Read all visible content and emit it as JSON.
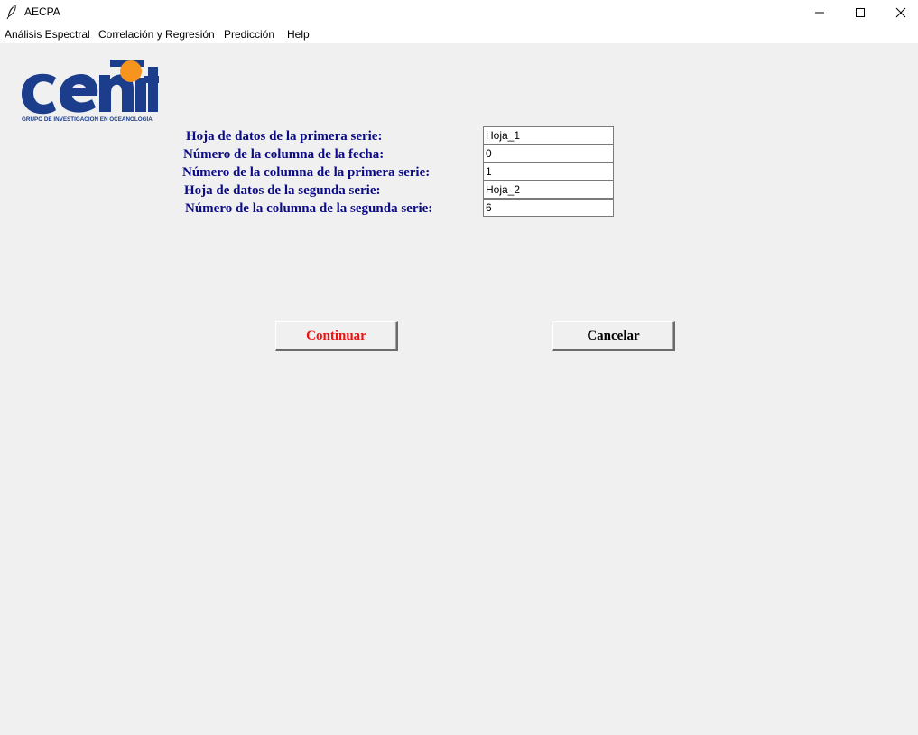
{
  "window": {
    "title": "AECPA",
    "icon": "feather-icon"
  },
  "menubar": {
    "items": [
      {
        "label": "Análisis Espectral"
      },
      {
        "label": "Correlación y Regresión"
      },
      {
        "label": "Predicción"
      },
      {
        "label": "Help"
      }
    ]
  },
  "logo": {
    "text": "cenit",
    "subtitle": "GRUPO DE INVESTIGACIÓN EN OCEANOLOGÍA",
    "colors": {
      "navy": "#1b3d8c",
      "orange": "#f7941d"
    }
  },
  "form": {
    "fields": [
      {
        "label": "Hoja de datos de la primera serie:",
        "value": "Hoja_1"
      },
      {
        "label": "Número de la columna de la fecha:",
        "value": "0"
      },
      {
        "label": "Número de la columna de la primera serie:",
        "value": "1"
      },
      {
        "label": "Hoja de datos de la segunda serie:",
        "value": "Hoja_2"
      },
      {
        "label": "Número de la columna de la segunda serie:",
        "value": "6"
      }
    ],
    "label_color": "#0b0b85"
  },
  "buttons": {
    "continue_label": "Continuar",
    "continue_color": "#ee1111",
    "cancel_label": "Cancelar"
  }
}
